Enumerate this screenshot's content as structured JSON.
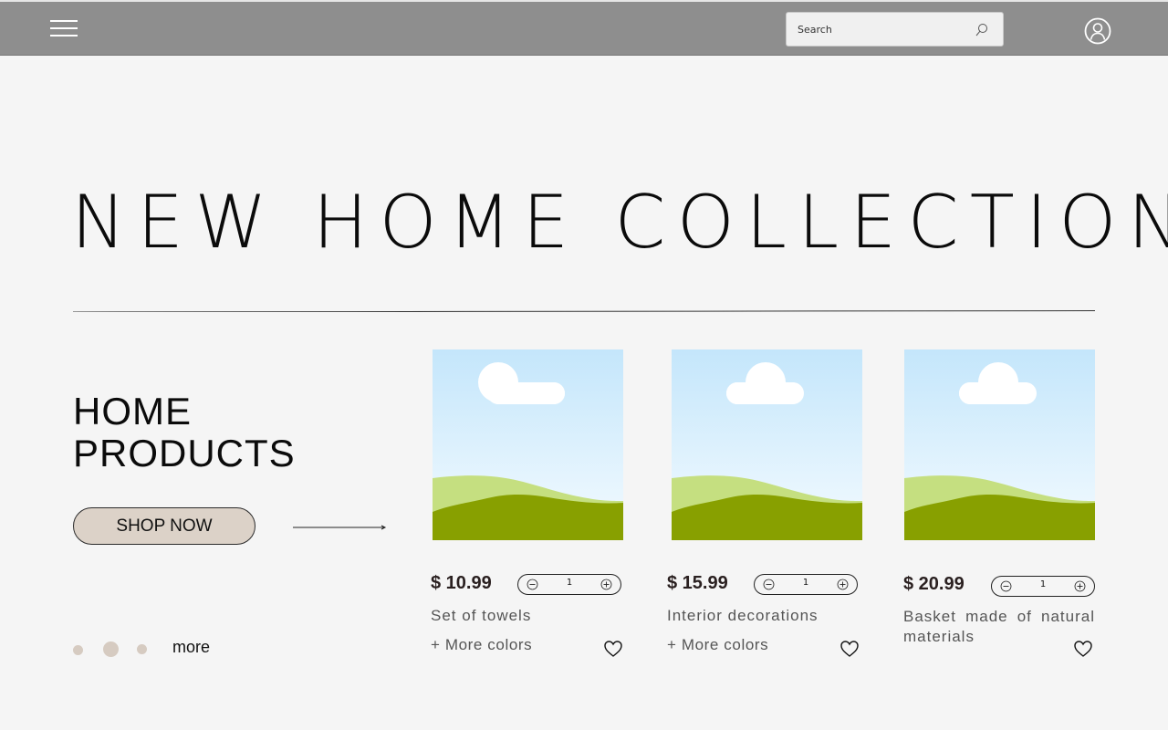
{
  "header": {
    "search_placeholder": "Search",
    "icons": [
      "menu-icon",
      "search-icon",
      "user-icon"
    ]
  },
  "hero": {
    "title": "NEW HOME COLLECTION"
  },
  "side": {
    "title_line1": "HOME",
    "title_line2": "PRODUCTS",
    "cta_label": "SHOP NOW",
    "more_label": "more"
  },
  "products": [
    {
      "price": "$ 10.99",
      "quantity": "1",
      "name": "Set of towels",
      "colors_label": "+ More colors"
    },
    {
      "price": "$ 15.99",
      "quantity": "1",
      "name": "Interior decorations",
      "colors_label": "+ More colors"
    },
    {
      "price": "$ 20.99",
      "quantity": "1",
      "name": "Basket made of natural materials",
      "colors_label": ""
    }
  ],
  "colors": {
    "header_bg": "#8e8e8e",
    "page_bg": "#f5f5f5",
    "accent_beige": "#dcd2c8",
    "sky": "#c4e6fb",
    "hill_light": "#c5df80",
    "hill_dark": "#88a000"
  }
}
